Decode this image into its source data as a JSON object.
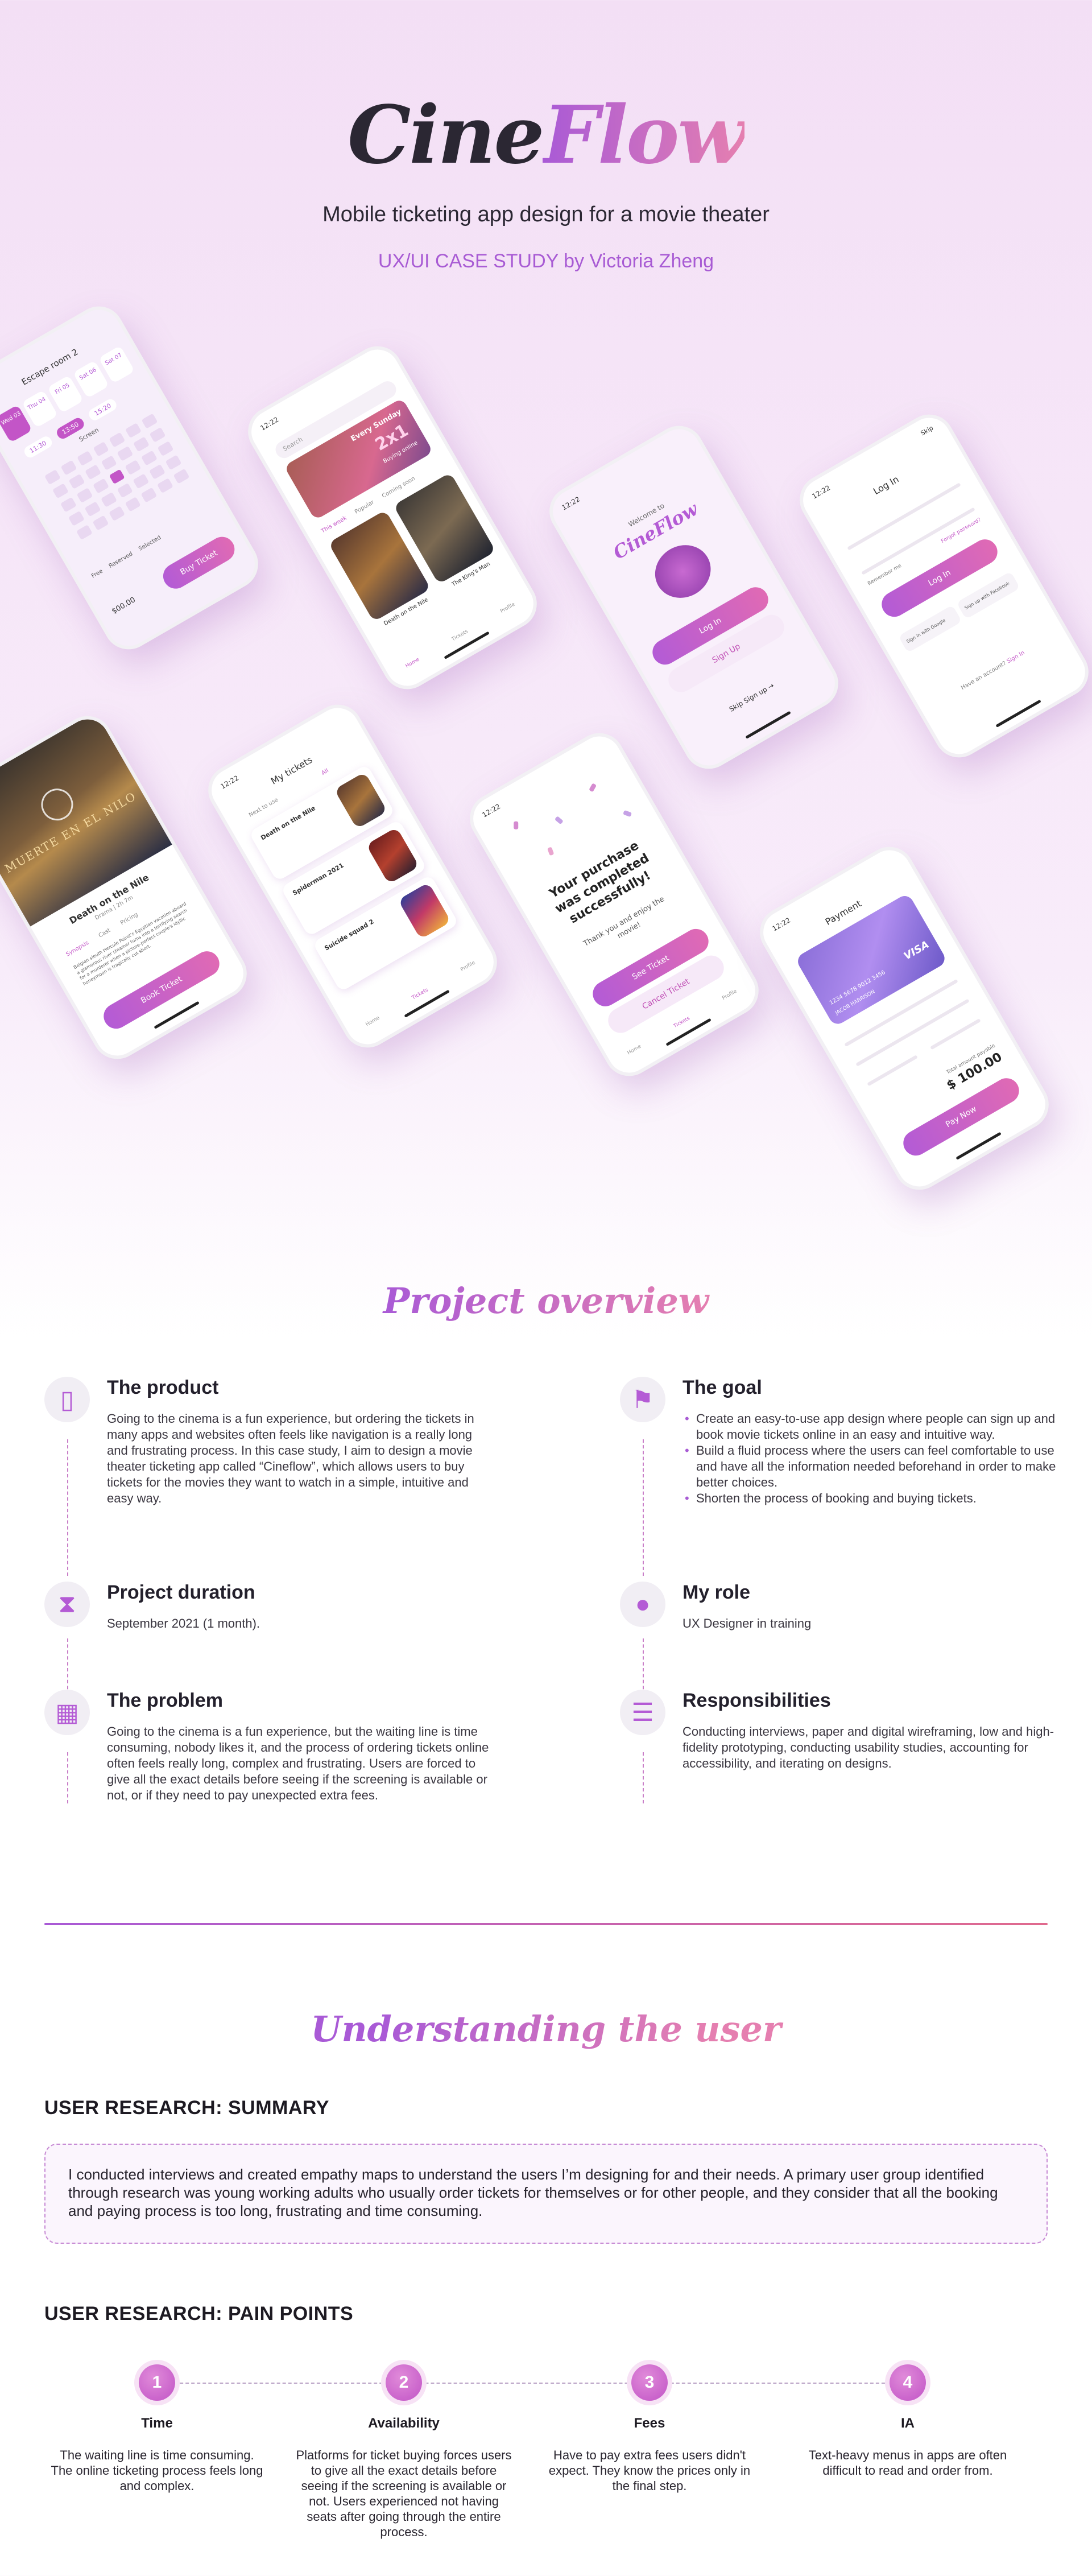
{
  "hero": {
    "brand_part1": "Cine",
    "brand_part2": "Flow",
    "subtitle": "Mobile ticketing app design for a movie theater",
    "tagline": "UX/UI CASE STUDY by Victoria Zheng"
  },
  "mockups": {
    "seat_screen": {
      "title": "Escape room 2",
      "dates": [
        "Wed 03",
        "Thu 04",
        "Fri 05",
        "Sat 06",
        "Sat 07"
      ],
      "times": [
        "11:30",
        "13:50",
        "15:20"
      ],
      "screen_label": "Screen",
      "legend": [
        "Free",
        "Reserved",
        "Selected"
      ],
      "price": "$00.00",
      "button": "Buy Ticket"
    },
    "home_screen": {
      "time": "12:22",
      "search_placeholder": "Search",
      "promo_title": "Every Sunday",
      "promo_value": "2x1",
      "promo_sub": "Buying online",
      "tabs": [
        "This week",
        "Popular",
        "Coming soon"
      ],
      "movies": [
        "Death on the Nile",
        "The King's Man"
      ],
      "nav": [
        "Home",
        "Tickets",
        "Profile"
      ]
    },
    "welcome_screen": {
      "time": "12:22",
      "welcome": "Welcome to",
      "logo": "CineFlow",
      "login": "Log In",
      "signup": "Sign Up",
      "skip": "Skip Sign up →"
    },
    "login_screen": {
      "time": "12:22",
      "skip": "Skip",
      "title": "Log In",
      "remember": "Remember me",
      "forgot": "Forgot password?",
      "button": "Log In",
      "google": "Sign in with Google",
      "facebook": "Sign up with Facebook",
      "footer": "Have an account?",
      "footer_link": "Sign In"
    },
    "detail_screen": {
      "poster_text": "MUERTE EN EL NILO",
      "title": "Death on the Nile",
      "meta": "Drama | 2h 7m",
      "tabs": [
        "Synopsis",
        "Cast",
        "Pricing"
      ],
      "synopsis": "Belgian sleuth Hercule Poirot's Egyptian vacation aboard a glamorous river steamer turns into a terrifying search for a murderer when a picture-perfect couple's idyllic honeymoon is tragically cut short.",
      "button": "Book Ticket"
    },
    "tickets_screen": {
      "time": "12:22",
      "title": "My tickets",
      "tabs": [
        "Next to use",
        "All"
      ],
      "tickets": [
        "Death on the Nile",
        "Spiderman 2021",
        "Suicide squad 2"
      ],
      "nav": [
        "Home",
        "Tickets",
        "Profile"
      ]
    },
    "success_screen": {
      "time": "12:22",
      "message": "Your purchase was completed successfully!",
      "thanks": "Thank you and enjoy the movie!",
      "see_ticket": "See Ticket",
      "cancel": "Cancel Ticket",
      "nav": [
        "Home",
        "Tickets",
        "Profile"
      ]
    },
    "payment_screen": {
      "time": "12:22",
      "title": "Payment",
      "card_number": "1234 5678 9012 3456",
      "card_brand": "VISA",
      "card_holder": "JACOB HARRISON",
      "total_label": "Total amount payable",
      "total": "$ 100.00",
      "button": "Pay Now"
    }
  },
  "overview": {
    "title": "Project overview",
    "product": {
      "heading": "The product",
      "text": "Going to the cinema is a fun experience, but ordering the tickets in many apps and websites often feels like navigation is a really long and frustrating process. In this case study, I aim to design a movie theater ticketing app called “Cineflow”, which allows users to buy tickets for the movies they want to watch in a simple, intuitive and easy way."
    },
    "goal": {
      "heading": "The goal",
      "bullets": [
        "Create an easy-to-use app design where people can sign up and book movie tickets online in an easy and intuitive way.",
        "Build a fluid process where the users can feel comfortable to use and have all the information needed beforehand in order to make better choices.",
        "Shorten the process of booking and buying tickets."
      ]
    },
    "duration": {
      "heading": "Project duration",
      "text": "September 2021 (1 month)."
    },
    "role": {
      "heading": "My role",
      "text": "UX Designer in training"
    },
    "problem": {
      "heading": "The problem",
      "text": "Going to the cinema is a fun experience, but the waiting line is time consuming, nobody likes it, and the process of ordering tickets online often feels really long, complex and frustrating. Users are forced to give all the exact details before seeing if the screening is available or not, or if they need to pay unexpected extra fees."
    },
    "responsibilities": {
      "heading": "Responsibilities",
      "text": "Conducting interviews, paper and digital wireframing, low and high-fidelity prototyping, conducting usability studies, accounting for accessibility, and iterating on designs."
    }
  },
  "understanding": {
    "title": "Understanding the user",
    "summary_heading": "USER RESEARCH: SUMMARY",
    "summary_text": "I conducted interviews and created empathy maps to understand the users I’m designing for and their needs. A primary user group identified through research was young working adults who usually order tickets for themselves or for other people, and they consider that all the booking and paying process is too long, frustrating and time consuming.",
    "pain_heading": "USER RESEARCH: PAIN POINTS",
    "pain_points": [
      {
        "num": "1",
        "title": "Time",
        "text": "The waiting line is time consuming. The online ticketing process feels long and complex."
      },
      {
        "num": "2",
        "title": "Availability",
        "text": "Platforms for ticket buying forces users to give all the exact details before seeing if the screening is available or not. Users experienced not having seats after going through the entire process."
      },
      {
        "num": "3",
        "title": "Fees",
        "text": "Have to pay extra fees users didn't expect. They know the prices only in the final step."
      },
      {
        "num": "4",
        "title": "IA",
        "text": "Text-heavy menus in apps are often difficult to read and order from."
      }
    ]
  },
  "colors": {
    "accent_purple": "#a95ad6",
    "accent_pink": "#e57fb0"
  }
}
